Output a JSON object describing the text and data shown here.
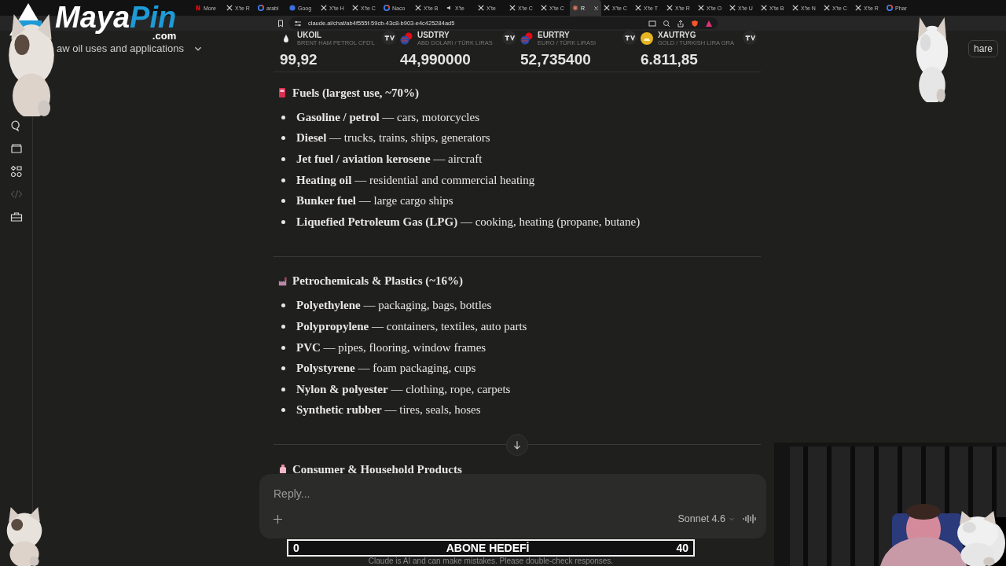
{
  "browser": {
    "tabs": [
      {
        "label": "More",
        "kind": "netflix",
        "selected": false
      },
      {
        "label": "X'te R",
        "kind": "x",
        "selected": false
      },
      {
        "label": "arabi",
        "kind": "google",
        "selected": false
      },
      {
        "label": "Goog",
        "kind": "globe",
        "selected": false
      },
      {
        "label": "X'te H",
        "kind": "x",
        "selected": false
      },
      {
        "label": "X'te C",
        "kind": "x",
        "selected": false
      },
      {
        "label": "Naco",
        "kind": "google",
        "selected": false
      },
      {
        "label": "X'te B",
        "kind": "x",
        "selected": false
      },
      {
        "label": "X'te",
        "kind": "speaker",
        "selected": false
      },
      {
        "label": "X'te",
        "kind": "x",
        "selected": false
      },
      {
        "label": "X'te C",
        "kind": "x",
        "selected": false
      },
      {
        "label": "X'te C",
        "kind": "x",
        "selected": false
      },
      {
        "label": "R",
        "kind": "claude",
        "selected": true
      },
      {
        "label": "X'te C",
        "kind": "x",
        "selected": false
      },
      {
        "label": "X'te T",
        "kind": "x",
        "selected": false
      },
      {
        "label": "X'te R",
        "kind": "x",
        "selected": false
      },
      {
        "label": "X'te O",
        "kind": "x",
        "selected": false
      },
      {
        "label": "X'te U",
        "kind": "x",
        "selected": false
      },
      {
        "label": "X'te B",
        "kind": "x",
        "selected": false
      },
      {
        "label": "X'te N",
        "kind": "x",
        "selected": false
      },
      {
        "label": "X'te C",
        "kind": "x",
        "selected": false
      },
      {
        "label": "X'te R",
        "kind": "x",
        "selected": false
      },
      {
        "label": "Phar",
        "kind": "google",
        "selected": false
      }
    ],
    "url": "claude.ai/chat/ab4f555f-59cb-43c8-b903-e4c425284ad5"
  },
  "overlay_logo": {
    "name_a": "Maya",
    "name_b": "Pin",
    "domain": ".com"
  },
  "header": {
    "chat_title": "aw oil uses and applications",
    "share": "hare"
  },
  "ticker": [
    {
      "symbol": "UKOIL",
      "name": "BRENT HAM PETROL CFD'L",
      "price": "99,92",
      "kind": "drop"
    },
    {
      "symbol": "USDTRY",
      "name": "ABD DOLARI / TÜRK LIRAS",
      "price": "44,990000",
      "kind": "flags"
    },
    {
      "symbol": "EURTRY",
      "name": "EURO / TÜRK LIRASI",
      "price": "52,735400",
      "kind": "flags"
    },
    {
      "symbol": "XAUTRYG",
      "name": "GOLD / TURKISH LIRA GRA",
      "price": "6.811,85",
      "kind": "gold"
    }
  ],
  "sidebar": [
    {
      "kind": "chats",
      "disabled": false
    },
    {
      "kind": "projects",
      "disabled": false
    },
    {
      "kind": "artifacts",
      "disabled": false
    },
    {
      "kind": "code",
      "disabled": true
    },
    {
      "kind": "toolbox",
      "disabled": false
    }
  ],
  "sections": [
    {
      "kind": "fuel",
      "heading": "Fuels (largest use, ~70%)",
      "items": [
        "**Gasoline / petrol** — cars, motorcycles",
        "**Diesel** — trucks, trains, ships, generators",
        "**Jet fuel / aviation kerosene** — aircraft",
        "**Heating oil** — residential and commercial heating",
        "**Bunker fuel** — large cargo ships",
        "**Liquefied Petroleum Gas (LPG)** — cooking, heating (propane, butane)"
      ]
    },
    {
      "kind": "factory",
      "heading": "Petrochemicals & Plastics (~16%)",
      "items": [
        "**Polyethylene** — packaging, bags, bottles",
        "**Polypropylene** — containers, textiles, auto parts",
        "**PVC** — pipes, flooring, window frames",
        "**Polystyrene** — foam packaging, cups",
        "**Nylon & polyester** — clothing, rope, carpets",
        "**Synthetic rubber** — tires, seals, hoses"
      ]
    },
    {
      "kind": "bottle",
      "heading": "Consumer & Household Products"
    }
  ],
  "composer": {
    "placeholder": "Reply...",
    "model": "Sonnet 4.6"
  },
  "subscriber_goal": {
    "start": "0",
    "title": "ABONE HEDEFİ",
    "target": "40"
  },
  "footer": "Claude is AI and can make mistakes. Please double-check responses."
}
